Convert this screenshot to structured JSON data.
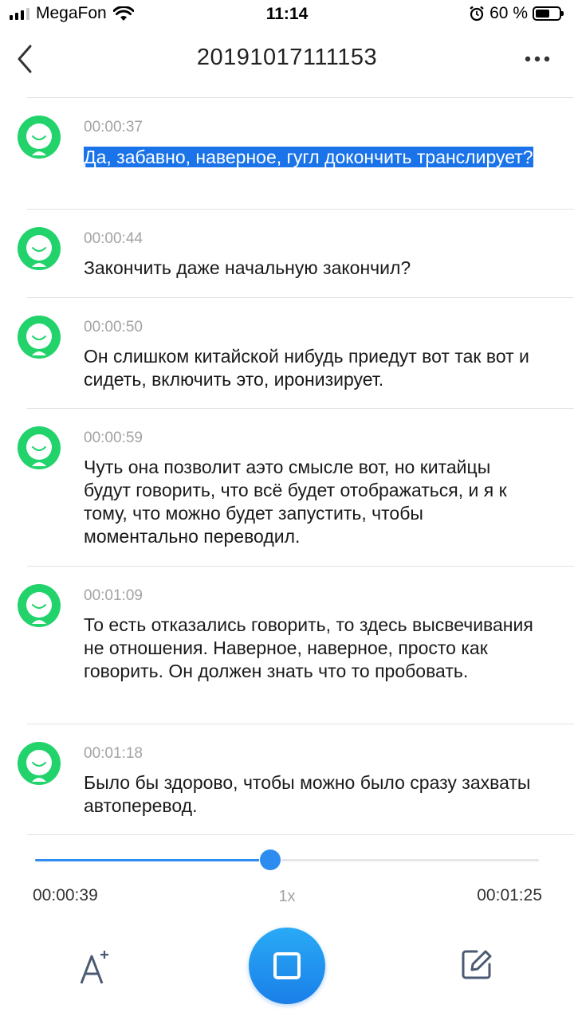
{
  "status_bar": {
    "carrier": "MegaFon",
    "time": "11:14",
    "battery_text": "60 %",
    "battery_level": 0.6,
    "icons": [
      "signal-icon",
      "wifi-icon",
      "alarm-icon",
      "battery-icon"
    ]
  },
  "nav": {
    "title": "20191017111153",
    "back_icon": "chevron-left-icon",
    "more_icon": "more-dots-icon"
  },
  "transcript": [
    {
      "time": "00:00:37",
      "text": "Да, забавно, наверное, гугл докончить транслирует?",
      "selected": true
    },
    {
      "time": "00:00:44",
      "text": "Закончить даже начальную закончил?"
    },
    {
      "time": "00:00:50",
      "text": "Он слишком китайской нибудь приедут вот так вот и сидеть, включить это, иронизирует."
    },
    {
      "time": "00:00:59",
      "text": "Чуть она позволит аэто смысле вот, но китайцы будут говорить, что всё будет отображаться, и я к тому, что можно будет запустить, чтобы моментально переводил."
    },
    {
      "time": "00:01:09",
      "text": "То есть отказались говорить, то здесь высвечивания не отношения. Наверное, наверное, просто как говорить. Он должен знать что то пробовать."
    },
    {
      "time": "00:01:18",
      "text": "Было бы здорово, чтобы можно было сразу захваты автоперевод."
    }
  ],
  "player": {
    "current_time": "00:00:39",
    "total_time": "00:01:25",
    "speed": "1x",
    "progress": 0.467,
    "accent_color": "#2d8cf0"
  },
  "toolbar": {
    "font_icon": "font-size-icon",
    "stop_icon": "stop-icon",
    "edit_icon": "edit-icon"
  },
  "colors": {
    "avatar_green": "#22d36c",
    "selection": "#1a73e8",
    "timestamp": "#a3a3a3"
  }
}
